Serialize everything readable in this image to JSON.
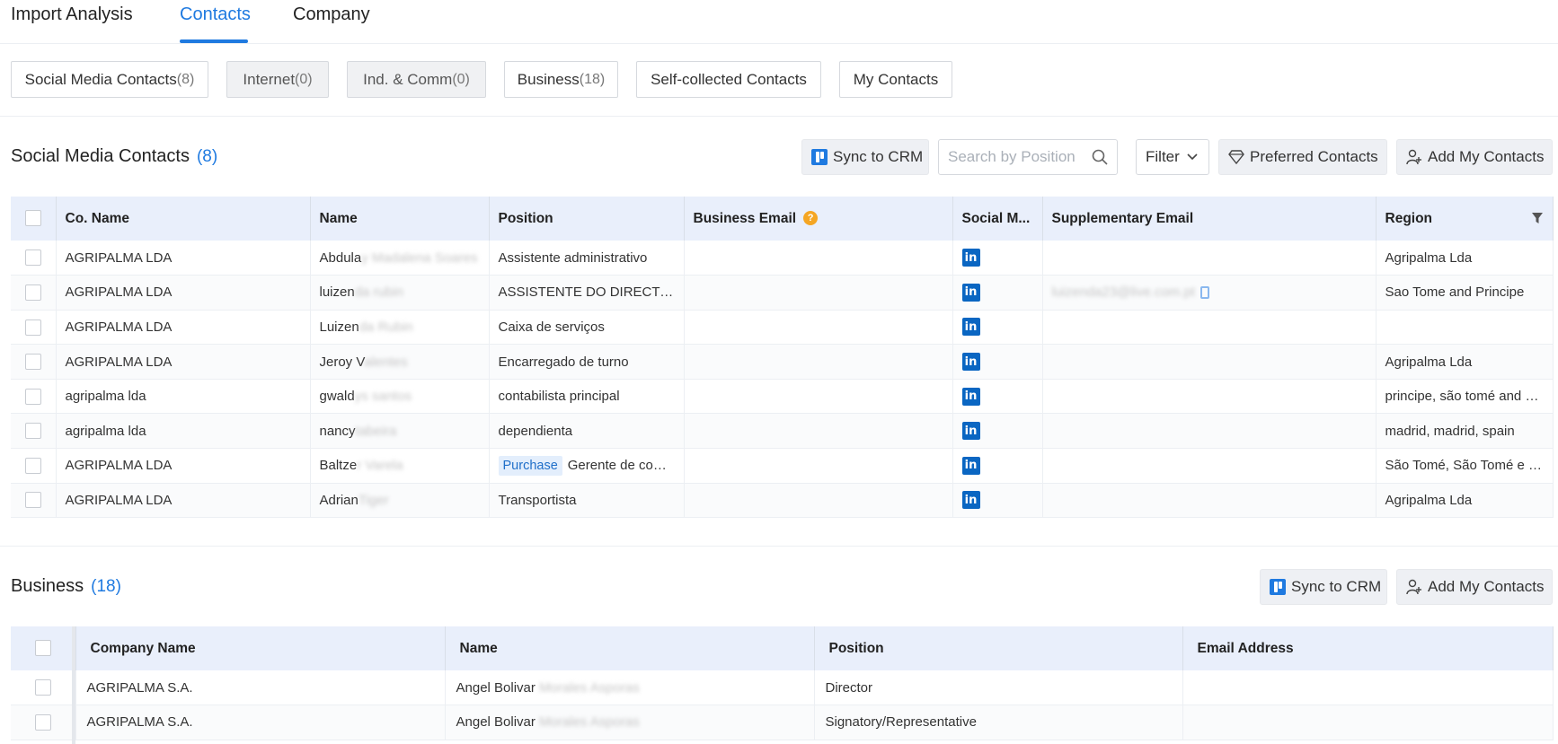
{
  "top_tabs": [
    "Import Analysis",
    "Contacts",
    "Company"
  ],
  "sub_tabs": [
    {
      "label": "Social Media Contacts",
      "count": "(8)"
    },
    {
      "label": "Internet",
      "count": "(0)"
    },
    {
      "label": "Ind. & Comm",
      "count": "(0)"
    },
    {
      "label": "Business",
      "count": "(18)"
    },
    {
      "label": "Self-collected Contacts",
      "count": ""
    },
    {
      "label": "My Contacts",
      "count": ""
    }
  ],
  "social": {
    "title": "Social Media Contacts",
    "count": "(8)",
    "sync_label": "Sync to CRM",
    "search_placeholder": "Search by Position",
    "filter_label": "Filter",
    "preferred_label": "Preferred Contacts",
    "add_label": "Add My Contacts",
    "columns": [
      "Co. Name",
      "Name",
      "Position",
      "Business Email",
      "Social M...",
      "Supplementary Email",
      "Region"
    ],
    "rows": [
      {
        "company": "AGRIPALMA LDA",
        "name": "Abdula",
        "name_hidden": "y Madalena Soares",
        "tag": "",
        "position": "Assistente administrativo",
        "supp": "",
        "region": "Agripalma Lda"
      },
      {
        "company": "AGRIPALMA LDA",
        "name": "luizen",
        "name_hidden": "da rubin",
        "tag": "",
        "position": "ASSISTENTE DO DIRECTO...",
        "supp": "luizenda23@live.com.pt",
        "region": "Sao Tome and Principe"
      },
      {
        "company": "AGRIPALMA LDA",
        "name": "Luizen",
        "name_hidden": "da Rubin",
        "tag": "",
        "position": "Caixa de serviços",
        "supp": "",
        "region": ""
      },
      {
        "company": "AGRIPALMA LDA",
        "name": "Jeroy V",
        "name_hidden": "alentes",
        "tag": "",
        "position": "Encarregado de turno",
        "supp": "",
        "region": "Agripalma Lda"
      },
      {
        "company": "agripalma lda",
        "name": "gwald",
        "name_hidden": "ys santos",
        "tag": "",
        "position": "contabilista principal",
        "supp": "",
        "region": "principe, são tomé and p..."
      },
      {
        "company": "agripalma lda",
        "name": "nancy",
        "name_hidden": "tabeira",
        "tag": "",
        "position": "dependienta",
        "supp": "",
        "region": "madrid, madrid, spain"
      },
      {
        "company": "AGRIPALMA LDA",
        "name": "Baltze",
        "name_hidden": "r Varela",
        "tag": "Purchase",
        "position": "Gerente de com...",
        "supp": "",
        "region": "São Tomé, São Tomé e P..."
      },
      {
        "company": "AGRIPALMA LDA",
        "name": "Adrian",
        "name_hidden": "Tiger",
        "tag": "",
        "position": "Transportista",
        "supp": "",
        "region": "Agripalma Lda"
      }
    ]
  },
  "business": {
    "title": "Business",
    "count": "(18)",
    "sync_label": "Sync to CRM",
    "add_label": "Add My Contacts",
    "columns": [
      "Company Name",
      "Name",
      "Position",
      "Email Address"
    ],
    "rows": [
      {
        "company": "AGRIPALMA S.A.",
        "name": "Angel Bolivar",
        "name_hidden": "Morales Asporas",
        "position": "Director",
        "email": ""
      },
      {
        "company": "AGRIPALMA S.A.",
        "name": "Angel Bolivar",
        "name_hidden": "Morales Asporas",
        "position": "Signatory/Representative",
        "email": ""
      }
    ]
  },
  "icons": {
    "linkedin": "in",
    "info": "?"
  },
  "colors": {
    "accent": "#1f7ae0",
    "linkedin": "#0a66c2",
    "header_bg": "#e9effb",
    "info": "#f5a623"
  }
}
